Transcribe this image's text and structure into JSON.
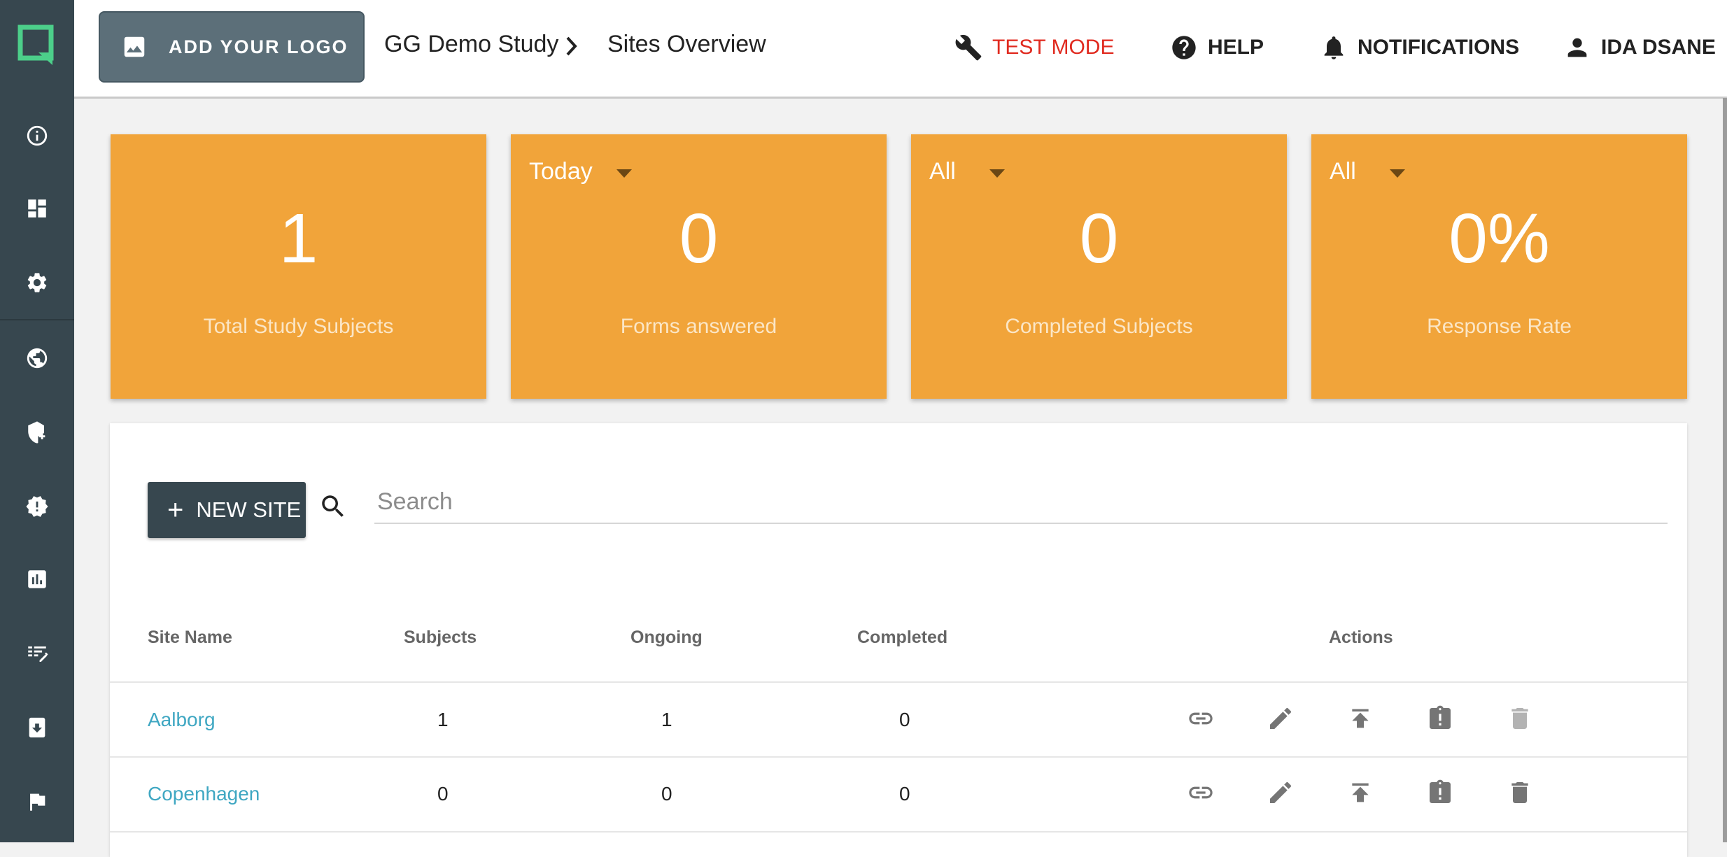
{
  "header": {
    "logo_button_label": "ADD YOUR LOGO",
    "study_name": "GG Demo Study",
    "page_title": "Sites Overview",
    "test_mode_label": "TEST MODE",
    "help_label": "HELP",
    "notifications_label": "NOTIFICATIONS",
    "user_name": "IDA DSANE",
    "test_mode_color": "#e02a1f"
  },
  "sidebar": {
    "icons": [
      "brand-logo-icon",
      "info-icon",
      "dashboard-icon",
      "settings-icon",
      "globe-icon",
      "security-add-icon",
      "alert-badge-icon",
      "chart-icon",
      "edit-list-icon",
      "download-file-icon",
      "flag-icon"
    ]
  },
  "stats": [
    {
      "value": "1",
      "label": "Total Study Subjects"
    },
    {
      "filter": "Today",
      "value": "0",
      "label": "Forms answered"
    },
    {
      "filter": "All",
      "value": "0",
      "label": "Completed Subjects"
    },
    {
      "filter": "All",
      "value": "0%",
      "label": "Response Rate"
    }
  ],
  "stats_color": "#f1a43a",
  "sites": {
    "new_site_label": "NEW SITE",
    "search_placeholder": "Search",
    "columns": [
      "Site Name",
      "Subjects",
      "Ongoing",
      "Completed",
      "Actions"
    ],
    "rows": [
      {
        "name": "Aalborg",
        "subjects": "1",
        "ongoing": "1",
        "completed": "0"
      },
      {
        "name": "Copenhagen",
        "subjects": "0",
        "ongoing": "0",
        "completed": "0"
      }
    ],
    "link_color": "#3fa7c2"
  }
}
